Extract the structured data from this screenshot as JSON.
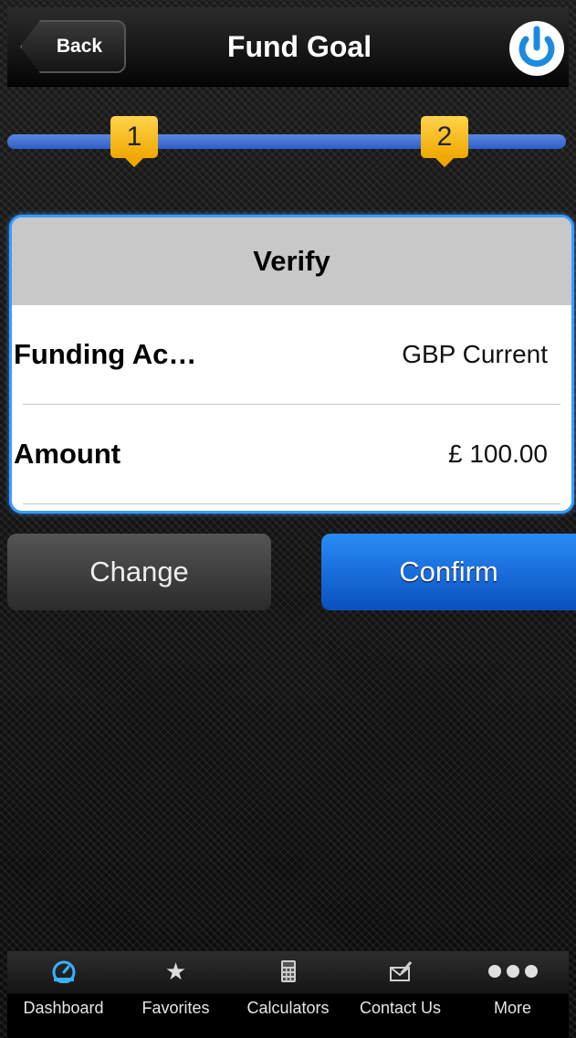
{
  "navbar": {
    "back_label": "Back",
    "title": "Fund Goal",
    "power_icon": "power-icon"
  },
  "steps": {
    "step1": "1",
    "step2": "2",
    "current_step": 1
  },
  "verify": {
    "title": "Verify",
    "rows": [
      {
        "label": "Funding Ac…",
        "value": "GBP Current"
      },
      {
        "label": "Amount",
        "value": "£ 100.00"
      }
    ]
  },
  "actions": {
    "change_label": "Change",
    "confirm_label": "Confirm"
  },
  "tabbar": {
    "items": [
      {
        "label": "Dashboard",
        "icon": "dashboard-icon",
        "active": true
      },
      {
        "label": "Favorites",
        "icon": "star-icon",
        "active": false
      },
      {
        "label": "Calculators",
        "icon": "calculator-icon",
        "active": false
      },
      {
        "label": "Contact Us",
        "icon": "contact-icon",
        "active": false
      },
      {
        "label": "More",
        "icon": "more-icon",
        "active": false
      }
    ]
  },
  "colors": {
    "accent_blue": "#2a8cf4",
    "step_marker": "#f5b800",
    "card_border": "#3c9cff"
  }
}
